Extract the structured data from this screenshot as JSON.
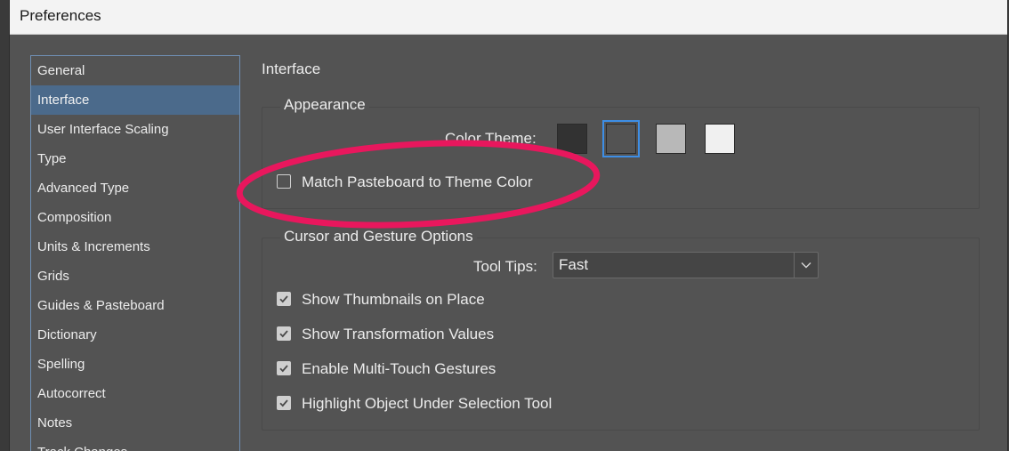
{
  "window": {
    "title": "Preferences"
  },
  "sidebar": {
    "items": [
      {
        "label": "General",
        "selected": false
      },
      {
        "label": "Interface",
        "selected": true
      },
      {
        "label": "User Interface Scaling",
        "selected": false
      },
      {
        "label": "Type",
        "selected": false
      },
      {
        "label": "Advanced Type",
        "selected": false
      },
      {
        "label": "Composition",
        "selected": false
      },
      {
        "label": "Units & Increments",
        "selected": false
      },
      {
        "label": "Grids",
        "selected": false
      },
      {
        "label": "Guides & Pasteboard",
        "selected": false
      },
      {
        "label": "Dictionary",
        "selected": false
      },
      {
        "label": "Spelling",
        "selected": false
      },
      {
        "label": "Autocorrect",
        "selected": false
      },
      {
        "label": "Notes",
        "selected": false
      },
      {
        "label": "Track Changes",
        "selected": false
      }
    ]
  },
  "main": {
    "title": "Interface",
    "appearance": {
      "legend": "Appearance",
      "color_theme_label": "Color Theme:",
      "themes": [
        {
          "name": "dark",
          "color": "#323232",
          "selected": false
        },
        {
          "name": "medium-dark",
          "color": "#535353",
          "selected": true
        },
        {
          "name": "medium-light",
          "color": "#b8b8b8",
          "selected": false
        },
        {
          "name": "light",
          "color": "#f0f0f0",
          "selected": false
        }
      ],
      "match_pasteboard_label": "Match Pasteboard to Theme Color",
      "match_pasteboard_checked": false
    },
    "cursor": {
      "legend": "Cursor and Gesture Options",
      "tool_tips_label": "Tool Tips:",
      "tool_tips_value": "Fast",
      "options": [
        {
          "label": "Show Thumbnails on Place",
          "checked": true
        },
        {
          "label": "Show Transformation Values",
          "checked": true
        },
        {
          "label": "Enable Multi-Touch Gestures",
          "checked": true
        },
        {
          "label": "Highlight Object Under Selection Tool",
          "checked": true
        }
      ]
    }
  },
  "colors": {
    "annotation": "#e8175d",
    "selection": "#4b6a8b",
    "focus": "#3d8ee6"
  }
}
